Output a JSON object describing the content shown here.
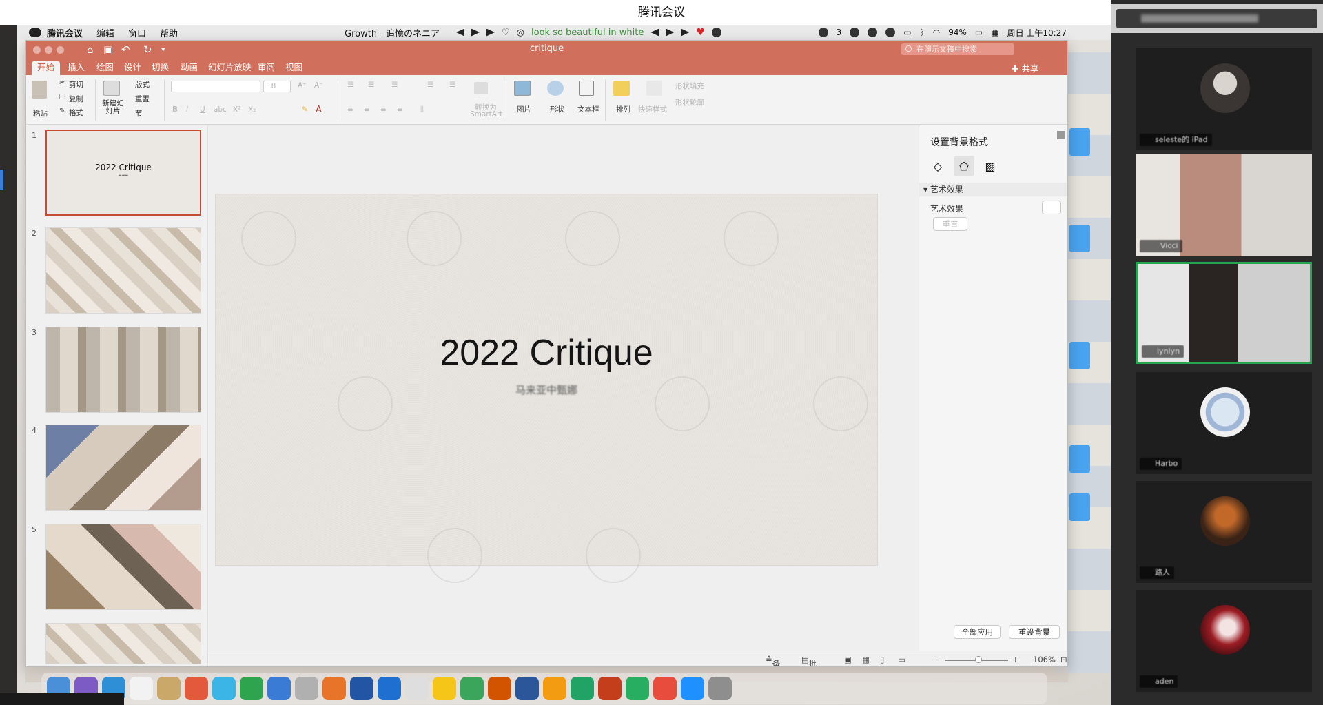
{
  "meeting": {
    "title": "腾讯会议"
  },
  "menubar": {
    "app": "腾讯会议",
    "items": [
      "编辑",
      "窗口",
      "帮助"
    ],
    "track": "Growth - 追憶のネニア",
    "lyric": "look so beautiful in white",
    "wechat_count": "3",
    "battery": "94%",
    "clock": "周日 上午10:27"
  },
  "ppt": {
    "doc_title": "critique",
    "search_placeholder": "在演示文稿中搜索",
    "share_label": "共享",
    "tabs": [
      {
        "label": "开始",
        "active": true
      },
      {
        "label": "插入",
        "active": false
      },
      {
        "label": "绘图",
        "active": false
      },
      {
        "label": "设计",
        "active": false
      },
      {
        "label": "切换",
        "active": false
      },
      {
        "label": "动画",
        "active": false
      },
      {
        "label": "幻灯片放映",
        "active": false
      },
      {
        "label": "审阅",
        "active": false
      },
      {
        "label": "视图",
        "active": false
      }
    ],
    "ribbon": {
      "paste": "粘贴",
      "cut": "剪切",
      "copy": "复制",
      "format": "格式",
      "new_slide": "新建幻灯片",
      "layout": "版式",
      "reset": "重置",
      "section": "节",
      "font_size": "18",
      "smartart": "转换为 SmartArt",
      "picture": "图片",
      "shape": "形状",
      "textbox": "文本框",
      "arrange": "排列",
      "quick_styles": "快速样式",
      "shape_fill": "形状填充",
      "shape_outline": "形状轮廓"
    },
    "slides": [
      {
        "num": "1",
        "title": "2022 Critique",
        "selected": true
      },
      {
        "num": "2"
      },
      {
        "num": "3"
      },
      {
        "num": "4"
      },
      {
        "num": "5"
      }
    ],
    "slide": {
      "title": "2022 Critique",
      "subtitle": "马来亚中甄娜"
    },
    "format_pane": {
      "title": "设置背景格式",
      "section": "艺术效果",
      "label": "艺术效果",
      "reset_small": "重置",
      "apply_all": "全部应用",
      "reset_bg": "重设背景"
    },
    "status": {
      "notes": "备注",
      "comments": "批注",
      "zoom": "106%"
    }
  },
  "participants": [
    {
      "name": "seleste的 iPad"
    },
    {
      "name": "Vicci"
    },
    {
      "name": "lynlyn"
    },
    {
      "name": "Harbo"
    },
    {
      "name": "路人"
    },
    {
      "name": "aden"
    }
  ],
  "colors": {
    "ppt_accent": "#d0705c",
    "active_speaker": "#26a650"
  }
}
